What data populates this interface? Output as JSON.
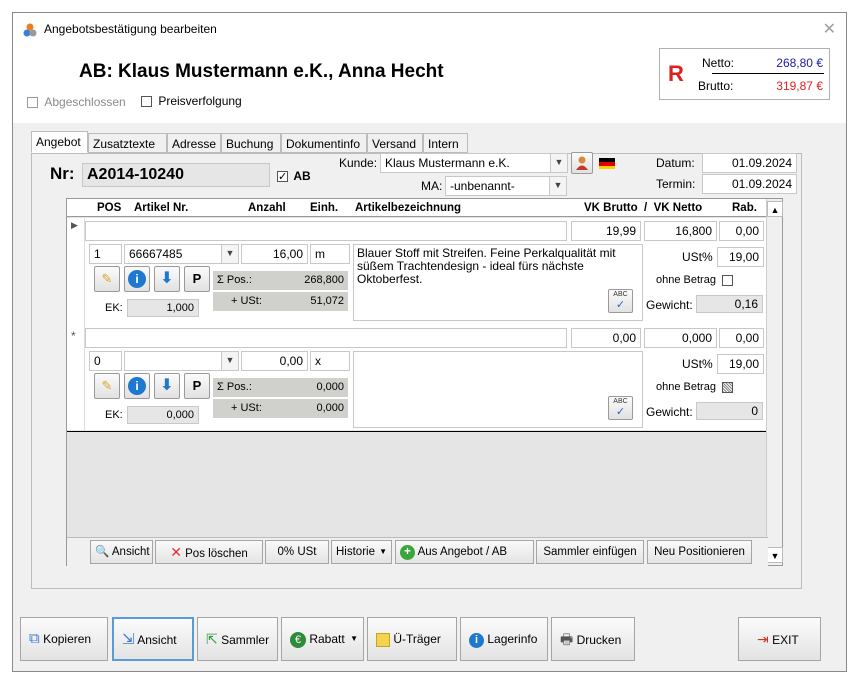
{
  "window": {
    "title": "Angebotsbestätigung bearbeiten"
  },
  "header": {
    "doc_title": "AB: Klaus Mustermann e.K., Anna Hecht",
    "abgeschlossen_label": "Abgeschlossen",
    "preisverfolgung_label": "Preisverfolgung",
    "status_letter": "R",
    "netto_label": "Netto:",
    "netto_value": "268,80 €",
    "brutto_label": "Brutto:",
    "brutto_value": "319,87 €",
    "colors": {
      "status": "#e02020",
      "netto": "#1a1aa8",
      "brutto": "#e02020"
    }
  },
  "tabs": [
    "Angebot",
    "Zusatztexte",
    "Adresse",
    "Buchung",
    "Dokumentinfo",
    "Versand",
    "Intern"
  ],
  "form": {
    "nr_label": "Nr:",
    "nr_value": "A2014-10240",
    "ab_label": "AB",
    "kunde_label": "Kunde:",
    "kunde_value": "Klaus Mustermann e.K.",
    "ma_label": "MA:",
    "ma_value": "-unbenannt-",
    "datum_label": "Datum:",
    "datum_value": "01.09.2024",
    "termin_label": "Termin:",
    "termin_value": "01.09.2024"
  },
  "grid": {
    "headers": {
      "pos": "POS",
      "artikel": "Artikel Nr.",
      "anzahl": "Anzahl",
      "einh": "Einh.",
      "bezeichnung": "Artikelbezeichnung",
      "vk": "VK Brutto  /  VK Netto",
      "rab": "Rab."
    },
    "rows": [
      {
        "marker": "▶",
        "vk_brutto": "19,99",
        "vk_netto": "16,800",
        "rabatt": "0,00",
        "pos": "1",
        "artikel": "66667485",
        "anzahl": "16,00",
        "einheit": "m",
        "bezeichnung": "Blauer Stoff mit Streifen. Feine Perkalqualität mit süßem Trachtendesign - ideal fürs nächste Oktoberfest.",
        "sum_pos_label": "Σ Pos.:",
        "sum_pos": "268,800",
        "ust_label": "+ USt:",
        "ust": "51,072",
        "ek_label": "EK:",
        "ek": "1,000",
        "ust_pct_label": "USt%",
        "ust_pct": "19,00",
        "ohne_betrag_label": "ohne Betrag",
        "gewicht_label": "Gewicht:",
        "gewicht": "0,16"
      },
      {
        "marker": "*",
        "vk_brutto": "0,00",
        "vk_netto": "0,000",
        "rabatt": "0,00",
        "pos": "0",
        "artikel": "",
        "anzahl": "0,00",
        "einheit": "x",
        "bezeichnung": "",
        "sum_pos_label": "Σ Pos.:",
        "sum_pos": "0,000",
        "ust_label": "+ USt:",
        "ust": "0,000",
        "ek_label": "EK:",
        "ek": "0,000",
        "ust_pct_label": "USt%",
        "ust_pct": "19,00",
        "ohne_betrag_label": "ohne Betrag",
        "gewicht_label": "Gewicht:",
        "gewicht": "0"
      }
    ],
    "p_label": "P",
    "spell_label": "ABC"
  },
  "grid_toolbar": {
    "ansicht": "Ansicht",
    "pos_loeschen": "Pos löschen",
    "ust0": "0% USt",
    "historie": "Historie",
    "aus_angebot": "Aus Angebot / AB",
    "sammler_einfuegen": "Sammler einfügen",
    "neu_positionieren": "Neu Positionieren"
  },
  "bottom_buttons": {
    "kopieren": "Kopieren",
    "ansicht": "Ansicht",
    "sammler": "Sammler",
    "rabatt": "Rabatt",
    "ue_traeger": "Ü-Träger",
    "lagerinfo": "Lagerinfo",
    "drucken": "Drucken",
    "exit": "EXIT"
  }
}
